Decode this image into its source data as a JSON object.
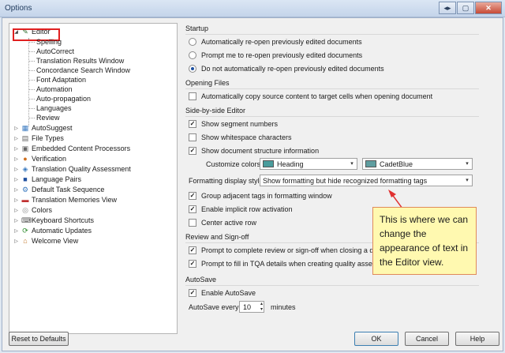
{
  "window": {
    "title": "Options",
    "controls": [
      "◂▸",
      "▢",
      "✕"
    ]
  },
  "tree": {
    "editor": {
      "label": "Editor",
      "children": [
        "Spelling",
        "AutoCorrect",
        "Translation Results Window",
        "Concordance Search Window",
        "Font Adaptation",
        "Automation",
        "Auto-propagation",
        "Languages",
        "Review"
      ]
    },
    "top_items": [
      "AutoSuggest",
      "File Types",
      "Embedded Content Processors",
      "Verification",
      "Translation Quality Assessment",
      "Language Pairs",
      "Default Task Sequence",
      "Translation Memories View",
      "Colors",
      "Keyboard Shortcuts",
      "Automatic Updates",
      "Welcome View"
    ]
  },
  "startup": {
    "heading": "Startup",
    "options": [
      "Automatically re-open previously edited documents",
      "Prompt me to re-open previously edited documents",
      "Do not automatically re-open previously edited documents"
    ],
    "selected_index": 2
  },
  "opening_files": {
    "heading": "Opening Files",
    "copy_source": "Automatically copy source content to target cells when opening document"
  },
  "side_by_side": {
    "heading": "Side-by-side Editor",
    "show_segment_numbers": "Show segment numbers",
    "show_whitespace": "Show whitespace characters",
    "show_structure": "Show document structure information",
    "customize_colors_label": "Customize colors:",
    "color1": {
      "name": "Heading",
      "hex": "#4a9c9c"
    },
    "color2": {
      "name": "CadetBlue",
      "hex": "#5f9ea0"
    },
    "formatting_label": "Formatting display style:",
    "formatting_value": "Show formatting but hide recognized formatting tags",
    "group_tags": "Group adjacent tags in formatting window",
    "implicit_row": "Enable implicit row activation",
    "center_row": "Center active row"
  },
  "review": {
    "heading": "Review and Sign-off",
    "prompt_review": "Prompt to complete review or sign-off when closing a document",
    "prompt_tqa": "Prompt to fill in TQA details when creating quality assessment ite"
  },
  "autosave": {
    "heading": "AutoSave",
    "enable": "Enable AutoSave",
    "every_label": "AutoSave every",
    "every_value": "10",
    "unit": "minutes"
  },
  "callout": "This is where we can change the appearance of text in the Editor view.",
  "buttons": {
    "reset": "Reset to Defaults",
    "ok": "OK",
    "cancel": "Cancel",
    "help": "Help"
  },
  "colors": {
    "selection_box": "#e02020",
    "callout_bg": "#fff9b0",
    "arrow": "#e03030"
  }
}
